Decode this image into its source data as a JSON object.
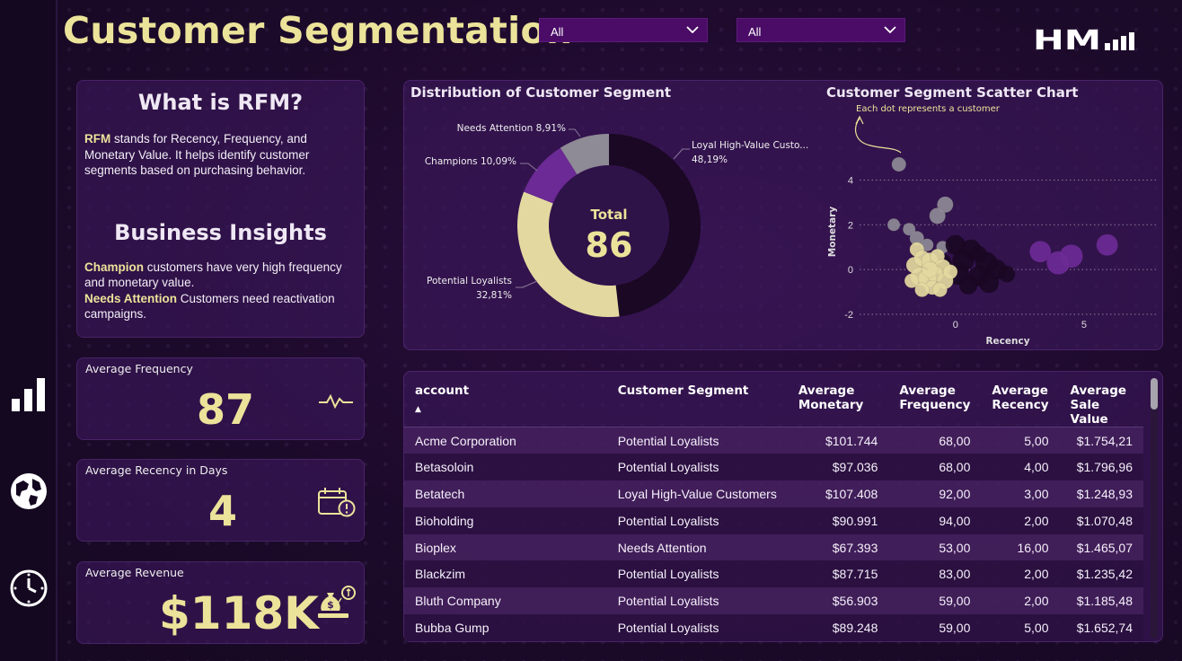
{
  "title": "Customer Segmentation",
  "filters": [
    {
      "value": "All"
    },
    {
      "value": "All"
    }
  ],
  "logo_text": "HM",
  "rfm": {
    "heading": "What is RFM?",
    "p1_bold": "RFM",
    "p1_text": " stands for Recency, Frequency, and Monetary Value. It helps identify customer segments based on purchasing behavior.",
    "insights_heading": "Business Insights",
    "ins1_bold": "Champion",
    "ins1_text": " customers have very high frequency and monetary value.",
    "ins2_bold": "Needs Attention",
    "ins2_text": " Customers need reactivation campaigns."
  },
  "kpis": {
    "frequency": {
      "label": "Average Frequency",
      "value": "87",
      "icon": "pulse-icon"
    },
    "recency": {
      "label": "Average Recency in Days",
      "value": "4",
      "icon": "calendar-alert-icon"
    },
    "revenue": {
      "label": "Average Revenue",
      "value": "$118K",
      "icon": "money-bag-icon"
    }
  },
  "nav_icons": [
    "bar-chart-icon",
    "globe-icon",
    "clock-icon"
  ],
  "colors": {
    "accent_yellow": "#ece39a",
    "loyal": "#1a0824",
    "potential": "#e3d9a0",
    "champions": "#6b2a95",
    "needs_attention": "#8e8a96",
    "dropdown_bg": "#4a0c66"
  },
  "donut": {
    "title": "Distribution of Customer Segment",
    "center_label": "Total",
    "center_value": "86",
    "chart_data": {
      "type": "pie",
      "slices": [
        {
          "name": "Loyal High-Value Custo...",
          "value": 48.19,
          "label": "48,19%"
        },
        {
          "name": "Potential Loyalists",
          "value": 32.81,
          "label": "32,81%"
        },
        {
          "name": "Champions",
          "value": 10.09,
          "label": "10,09%"
        },
        {
          "name": "Needs Attention",
          "value": 8.91,
          "label": "8,91%"
        }
      ]
    }
  },
  "scatter": {
    "title": "Customer Segment Scatter Chart",
    "annotation": "Each dot represents a customer",
    "chart_data": {
      "type": "scatter",
      "xlabel": "Recency",
      "ylabel": "Monetary",
      "xlim": [
        -3.1,
        7.9
      ],
      "ylim": [
        -2.4,
        4.9
      ],
      "xticks": [
        "0",
        "5"
      ],
      "yticks": [
        "4",
        "2",
        "0",
        "-2"
      ],
      "series": [
        {
          "color": "#8e8a96",
          "points": [
            [
              -2.2,
              4.7,
              8
            ],
            [
              -2.4,
              2.0,
              7
            ],
            [
              -1.8,
              1.8,
              7
            ],
            [
              -0.4,
              2.9,
              9
            ],
            [
              -0.7,
              2.4,
              9
            ],
            [
              -1.5,
              1.4,
              8
            ],
            [
              -1.1,
              1.1,
              7
            ],
            [
              -0.5,
              1.0,
              7
            ]
          ]
        },
        {
          "color": "#6b2a95",
          "points": [
            [
              3.3,
              0.8,
              12
            ],
            [
              4.5,
              0.6,
              13
            ],
            [
              5.9,
              1.1,
              12
            ],
            [
              4.0,
              0.3,
              13
            ]
          ]
        },
        {
          "color": "#1a0824",
          "points": [
            [
              0.0,
              1.1,
              11
            ],
            [
              0.6,
              0.9,
              11
            ],
            [
              0.3,
              0.4,
              12
            ],
            [
              1.2,
              0.3,
              12
            ],
            [
              0.9,
              -0.3,
              11
            ],
            [
              1.6,
              0.0,
              11
            ],
            [
              0.1,
              -0.2,
              12
            ],
            [
              0.5,
              -0.7,
              10
            ],
            [
              1.3,
              -0.6,
              11
            ],
            [
              -0.5,
              0.3,
              10
            ],
            [
              2.0,
              -0.2,
              9
            ],
            [
              0.9,
              0.7,
              9
            ]
          ]
        },
        {
          "color": "#e3d9a0",
          "points": [
            [
              -1.5,
              0.9,
              8
            ],
            [
              -1.6,
              0.2,
              9
            ],
            [
              -1.3,
              0.5,
              9
            ],
            [
              -1.0,
              0.4,
              9
            ],
            [
              -0.7,
              0.6,
              8
            ],
            [
              -0.5,
              0.1,
              9
            ],
            [
              -1.4,
              -0.3,
              10
            ],
            [
              -1.1,
              -0.4,
              10
            ],
            [
              -0.8,
              -0.2,
              9
            ],
            [
              -0.4,
              -0.5,
              9
            ],
            [
              -0.9,
              -0.8,
              8
            ],
            [
              -1.3,
              -0.9,
              8
            ],
            [
              -0.6,
              -0.9,
              8
            ],
            [
              -0.2,
              -0.1,
              8
            ],
            [
              -1.7,
              -0.5,
              8
            ],
            [
              -1.0,
              0.0,
              9
            ]
          ]
        }
      ]
    }
  },
  "table": {
    "headers": [
      "account",
      "Customer Segment",
      "Average Monetary",
      "Average Frequency",
      "Average Recency",
      "Average Sale Value"
    ],
    "sort_indicator": "▲",
    "rows": [
      [
        "Acme Corporation",
        "Potential Loyalists",
        "$101.744",
        "68,00",
        "5,00",
        "$1.754,21"
      ],
      [
        "Betasoloin",
        "Potential Loyalists",
        "$97.036",
        "68,00",
        "4,00",
        "$1.796,96"
      ],
      [
        "Betatech",
        "Loyal High-Value Customers",
        "$107.408",
        "92,00",
        "3,00",
        "$1.248,93"
      ],
      [
        "Bioholding",
        "Potential Loyalists",
        "$90.991",
        "94,00",
        "2,00",
        "$1.070,48"
      ],
      [
        "Bioplex",
        "Needs Attention",
        "$67.393",
        "53,00",
        "16,00",
        "$1.465,07"
      ],
      [
        "Blackzim",
        "Potential Loyalists",
        "$87.715",
        "83,00",
        "2,00",
        "$1.235,42"
      ],
      [
        "Bluth Company",
        "Potential Loyalists",
        "$56.903",
        "59,00",
        "2,00",
        "$1.185,48"
      ],
      [
        "Bubba Gump",
        "Potential Loyalists",
        "$89.248",
        "59,00",
        "5,00",
        "$1.652,74"
      ]
    ]
  }
}
